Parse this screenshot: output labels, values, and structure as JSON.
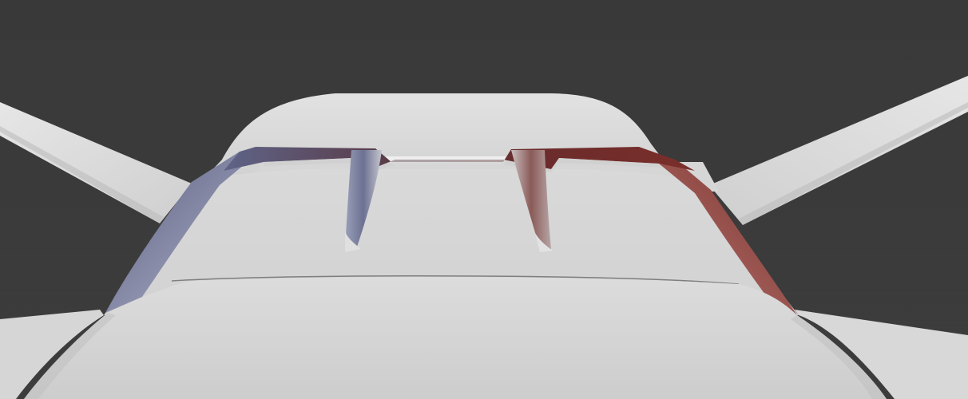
{
  "scene": {
    "viewport_background": "#3a3a3a",
    "model_color": "#d8d8d8",
    "gradient_left_color": "#6b6f8a",
    "gradient_right_color": "#7a3030",
    "description_items": [
      "left-wing",
      "right-wing",
      "rear-fairing",
      "spoiler-wing",
      "spoiler-support-left",
      "spoiler-support-right",
      "deck",
      "hull"
    ]
  }
}
